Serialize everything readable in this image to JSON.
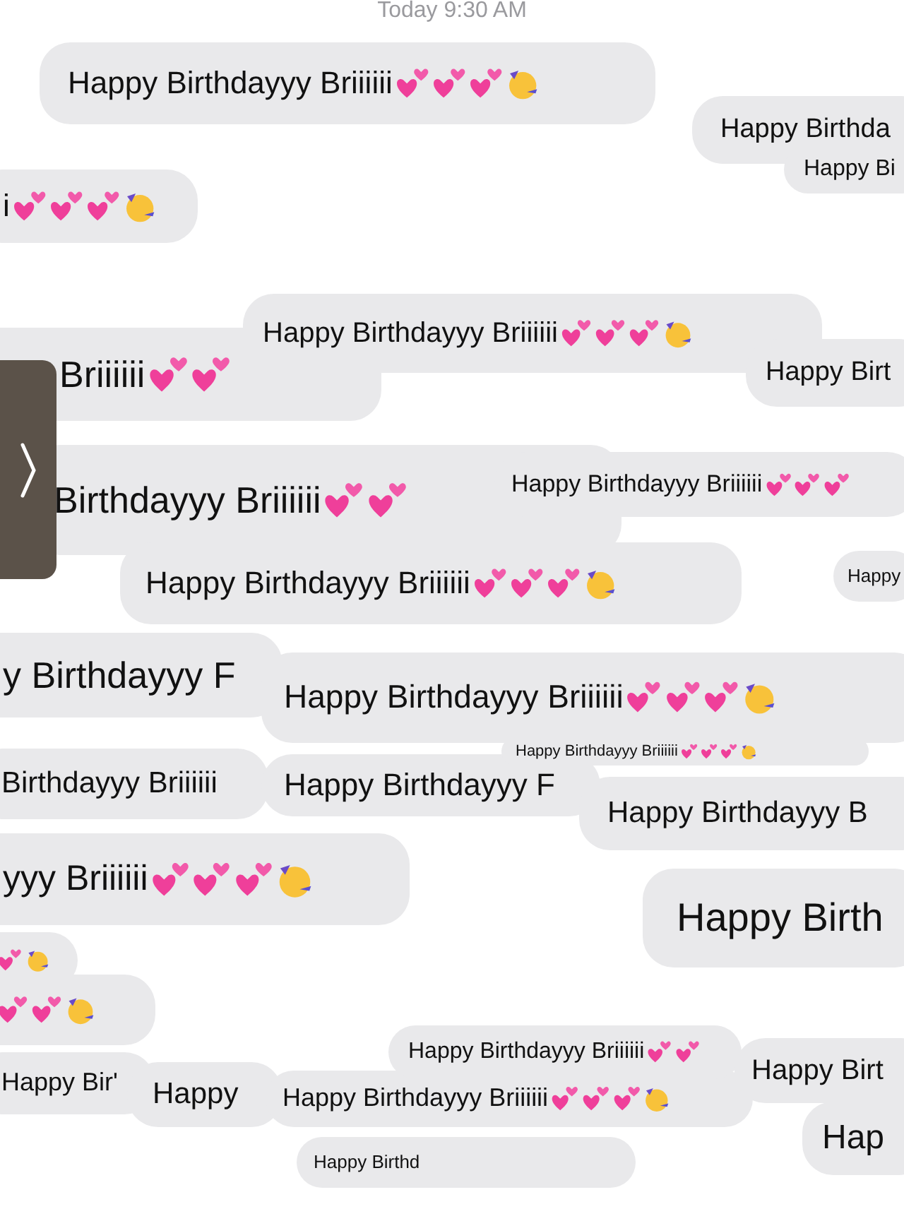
{
  "timestamp": "Today 9:30 AM",
  "messages": [
    {
      "text": "Happy Birthdayyy Briiiiii",
      "kind": "hearts_party"
    },
    {
      "text": "Happy Birthda",
      "kind": "plain"
    },
    {
      "text": "Happy Bi",
      "kind": "plain"
    },
    {
      "text": "i",
      "kind": "hearts_party"
    },
    {
      "text": "Briiiiii",
      "kind": "hearts"
    },
    {
      "text": "Happy Birthdayyy Briiiiii",
      "kind": "hearts_party"
    },
    {
      "text": "Happy Birt",
      "kind": "plain"
    },
    {
      "text": "Birthdayyy Briiiiii",
      "kind": "hearts"
    },
    {
      "text": "Happy Birthdayyy Briiiiii",
      "kind": "hearts"
    },
    {
      "text": "Happy Birthdayyy Briiiiii",
      "kind": "hearts_party"
    },
    {
      "text": "Happy",
      "kind": "plain"
    },
    {
      "text": "y Birthdayyy F",
      "kind": "plain"
    },
    {
      "text": "Happy Birthdayyy Briiiiii",
      "kind": "hearts_party"
    },
    {
      "text": "Happy Birthdayyy Briiiiii",
      "kind": "hearts_party"
    },
    {
      "text": "Birthdayyy Briiiiii",
      "kind": "plain"
    },
    {
      "text": "Happy Birthdayyy F",
      "kind": "plain"
    },
    {
      "text": "Happy Birthdayyy B",
      "kind": "plain"
    },
    {
      "text": "yyy Briiiiii",
      "kind": "hearts_party"
    },
    {
      "text": "Happy Birth",
      "kind": "plain"
    },
    {
      "kind": "hearts_party"
    },
    {
      "kind": "hearts_party"
    },
    {
      "text": "Happy Bir'",
      "kind": "plain"
    },
    {
      "text": "Happy",
      "kind": "plain"
    },
    {
      "text": "Happy Birthdayyy Briiiiii",
      "kind": "hearts_party"
    },
    {
      "text": "Happy Birthdayyy Briiiiii",
      "kind": "hearts"
    },
    {
      "text": "Happy Birt",
      "kind": "plain"
    },
    {
      "text": "Hap",
      "kind": "plain"
    },
    {
      "text": "Happy Birthd",
      "kind": "plain"
    }
  ],
  "side_handle": {
    "kind": "chevron"
  }
}
